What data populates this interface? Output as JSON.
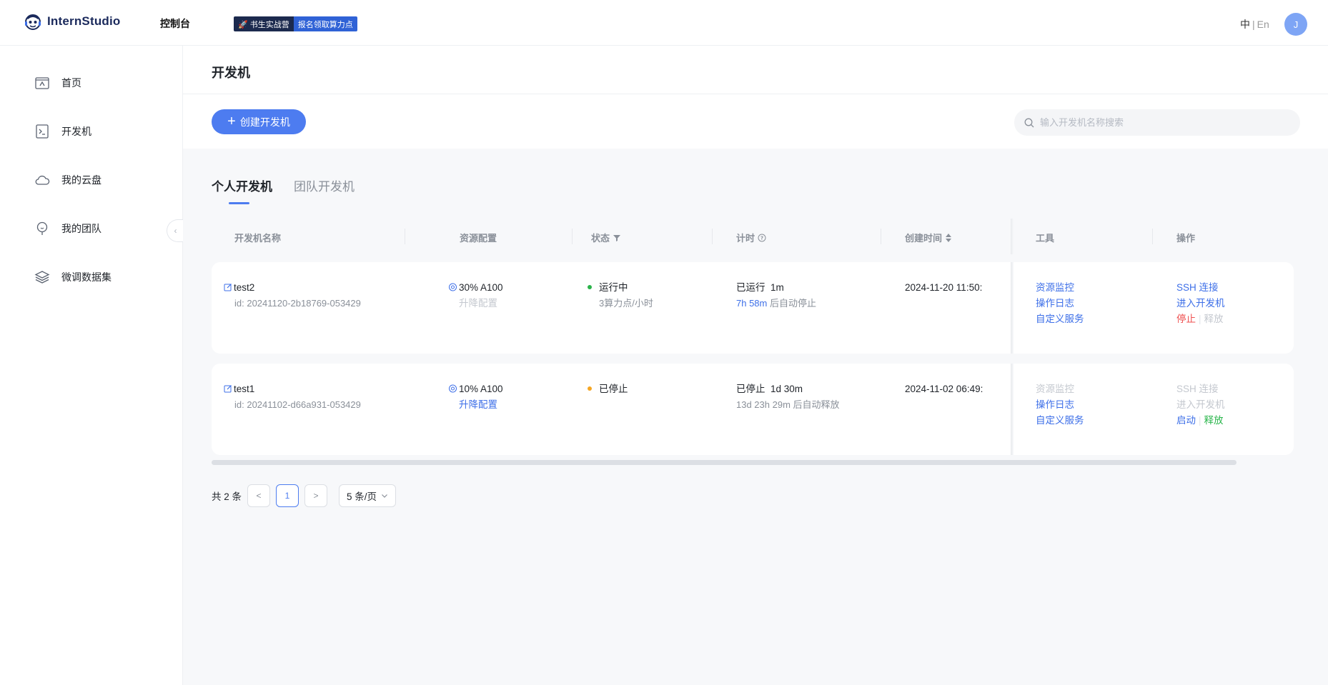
{
  "app": {
    "name": "InternStudio"
  },
  "header": {
    "console": "控制台",
    "promo_left": "书生实战营",
    "promo_right": "报名领取算力点",
    "lang_zh": "中",
    "lang_sep": "|",
    "lang_en": "En",
    "avatar": "J"
  },
  "sidebar": {
    "items": [
      {
        "label": "首页",
        "icon": "home-icon"
      },
      {
        "label": "开发机",
        "icon": "terminal-icon"
      },
      {
        "label": "我的云盘",
        "icon": "cloud-icon"
      },
      {
        "label": "我的团队",
        "icon": "team-icon"
      },
      {
        "label": "微调数据集",
        "icon": "layers-icon"
      }
    ],
    "collapse_glyph": "‹"
  },
  "page": {
    "title": "开发机",
    "create_label": "创建开发机",
    "search_placeholder": "输入开发机名称搜索"
  },
  "tabs": [
    {
      "label": "个人开发机",
      "active": true
    },
    {
      "label": "团队开发机",
      "active": false
    }
  ],
  "table": {
    "columns": {
      "name": "开发机名称",
      "resource": "资源配置",
      "status": "状态",
      "timer": "计时",
      "created": "创建时间",
      "tools": "工具",
      "actions": "操作"
    },
    "rows": [
      {
        "name": "test2",
        "id": "id: 20241120-2b18769-053429",
        "resource": "30% A100",
        "resize": "升降配置",
        "status": "运行中",
        "status_color": "#2bb34a",
        "status_sub": "3算力点/小时",
        "timer_main": "已运行  1m",
        "timer_highlight": "7h 58m",
        "timer_sub": " 后自动停止",
        "created": "2024-11-20 11:50:",
        "tool_monitor": "资源监控",
        "tool_log": "操作日志",
        "tool_service": "自定义服务",
        "act_ssh": "SSH 连接",
        "act_enter": "进入开发机",
        "act_primary": "停止",
        "act_release": "释放"
      },
      {
        "name": "test1",
        "id": "id: 20241102-d66a931-053429",
        "resource": "10% A100",
        "resize": "升降配置",
        "status": "已停止",
        "status_color": "#f5a623",
        "status_sub": "",
        "timer_main": "已停止  1d 30m",
        "timer_highlight": "",
        "timer_sub": "13d 23h 29m 后自动释放",
        "created": "2024-11-02 06:49:",
        "tool_monitor": "资源监控",
        "tool_log": "操作日志",
        "tool_service": "自定义服务",
        "act_ssh": "SSH 连接",
        "act_enter": "进入开发机",
        "act_primary": "启动",
        "act_release": "释放"
      }
    ]
  },
  "pager": {
    "total": "共 2 条",
    "page": "1",
    "size": "5 条/页"
  },
  "colors": {
    "accent": "#4d7cf0",
    "danger": "#ef4f4f",
    "success": "#28b54a"
  }
}
